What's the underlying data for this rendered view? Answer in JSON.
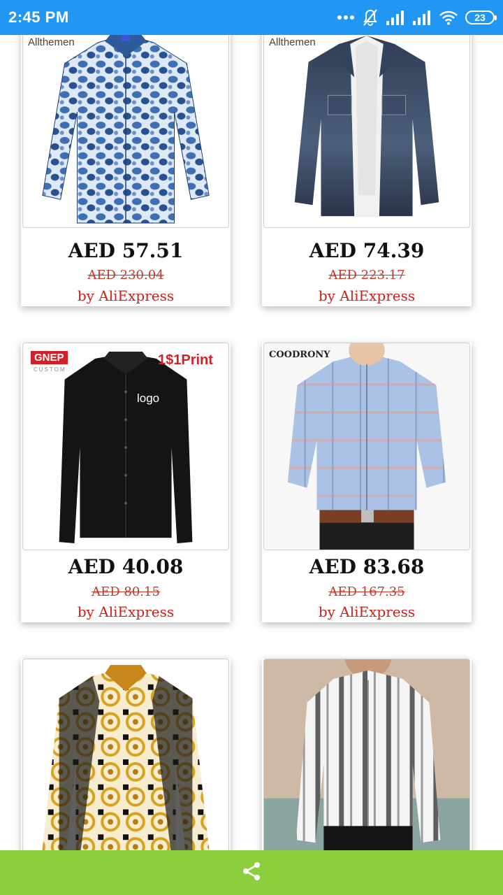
{
  "status_bar": {
    "time": "2:45 PM",
    "battery": "23"
  },
  "products": [
    {
      "brand": "Allthemen",
      "price": "AED 57.51",
      "old_price": "AED 230.04",
      "seller": "by AliExpress",
      "image": "blue-pattern-shirt"
    },
    {
      "brand": "Allthemen",
      "price": "AED 74.39",
      "old_price": "AED 223.17",
      "seller": "by AliExpress",
      "image": "denim-shirt"
    },
    {
      "brand": "GNEP",
      "brand_sub": "CUSTOM",
      "promo": "1$1Print",
      "shirt_text": "logo",
      "price": "AED 40.08",
      "old_price": "AED 80.15",
      "seller": "by AliExpress",
      "image": "black-shirt"
    },
    {
      "brand": "COODRONY",
      "price": "AED 83.68",
      "old_price": "AED 167.35",
      "seller": "by AliExpress",
      "image": "plaid-shirt"
    },
    {
      "price": "",
      "image": "baroque-shirt"
    },
    {
      "price": "",
      "image": "striped-shirt"
    }
  ],
  "bottom_bar": {
    "share_icon": "share-icon"
  },
  "colors": {
    "status_bar": "#2196f3",
    "bottom_bar": "#8dce3c",
    "seller_text": "#cc1f1a"
  }
}
